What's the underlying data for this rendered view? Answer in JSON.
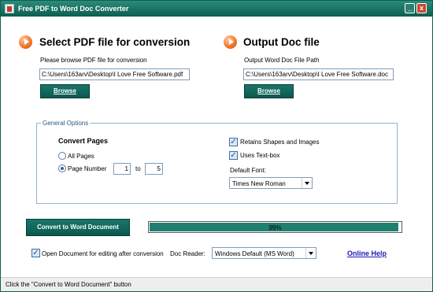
{
  "window": {
    "title": "Free PDF to Word Doc Converter",
    "minimize_label": "_",
    "close_label": "x"
  },
  "input_section": {
    "heading": "Select PDF file for conversion",
    "description": "Please browse PDF file for conversion",
    "path_value": "C:\\Users\\163arv\\Desktop\\I Love Free Software.pdf",
    "browse_label": "Browse"
  },
  "output_section": {
    "heading": "Output Doc file",
    "description": "Output Word Doc File Path",
    "path_value": "C:\\Users\\163arv\\Desktop\\I Love Free Software.doc",
    "browse_label": "Browse"
  },
  "options": {
    "legend": "General Options",
    "convert_pages_heading": "Convert Pages",
    "all_pages_label": "All Pages",
    "page_number_label": "Page Number",
    "from_page": "1",
    "to_label": "to",
    "to_page": "5",
    "retain_shapes_label": "Retains Shapes and Images",
    "uses_textbox_label": "Uses Text-box",
    "default_font_label": "Default Font:",
    "default_font_value": "Times New Roman"
  },
  "actions": {
    "convert_label": "Convert to Word Document",
    "progress_percent": 99,
    "progress_text": "99%"
  },
  "footer": {
    "open_after_label": "Open Document for editing after conversion",
    "doc_reader_label": "Doc Reader:",
    "doc_reader_value": "Windows Default (MS Word)",
    "online_help_label": "Online Help"
  },
  "status": {
    "text": "Click the \"Convert to Word Document\" button"
  },
  "colors": {
    "accent": "#0c5e50",
    "progress_fill": "#1f7f70",
    "link": "#1a1ab8"
  }
}
